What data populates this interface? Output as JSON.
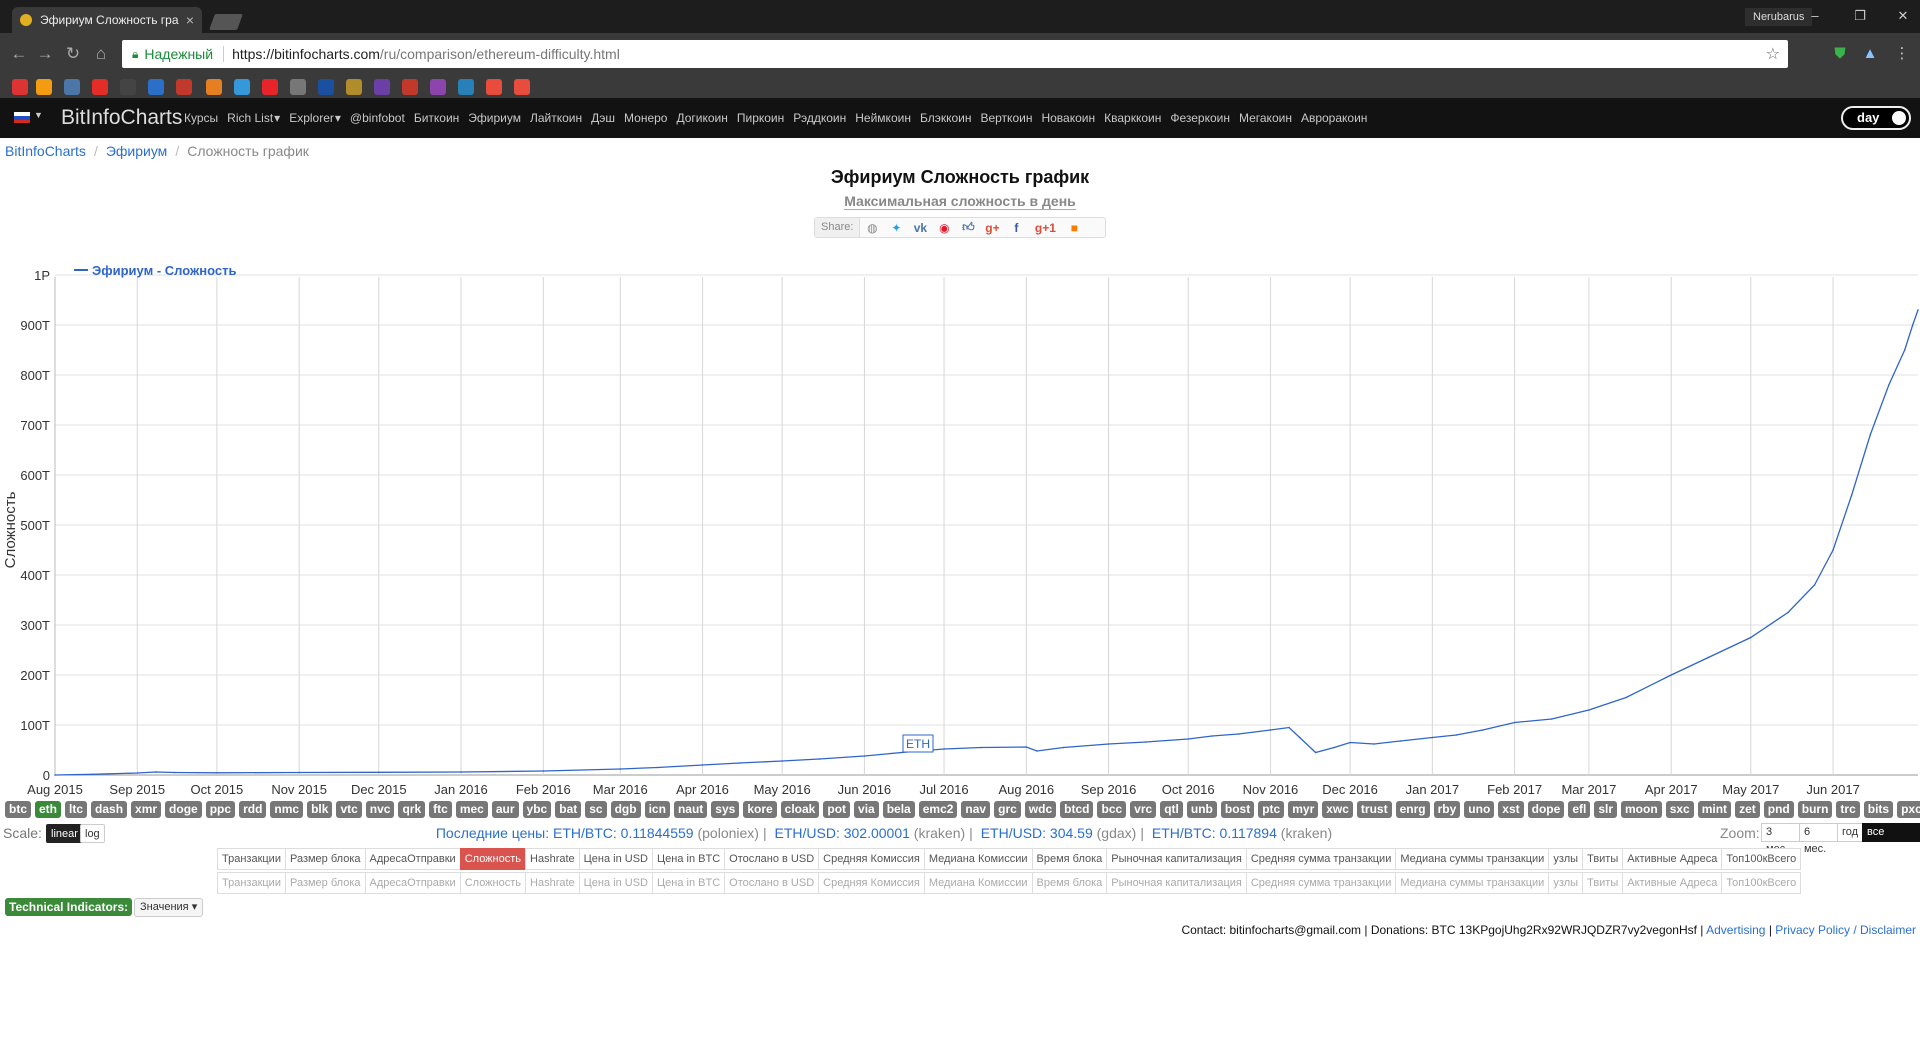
{
  "browser": {
    "tab_title": "Эфириум Сложность гра",
    "profile": "Nerubarus",
    "secure_label": "Надежный",
    "url_host": "https://bitinfocharts.com",
    "url_path": "/ru/comparison/ethereum-difficulty.html",
    "colors": {
      "chrome": "#3a3a3a",
      "tabbar": "#1d1d1d",
      "secure": "#1b8a3a"
    }
  },
  "site": {
    "brand": "BitInfoCharts",
    "nav": [
      "Курсы",
      "Rich List",
      "Explorer",
      "@binfobot",
      "Биткоин",
      "Эфириум",
      "Лайткоин",
      "Дэш",
      "Монеро",
      "Догикоин",
      "Пиркоин",
      "Рэддкоин",
      "Неймкоин",
      "Блэккоин",
      "Верткоин",
      "Новакоин",
      "Кварккоин",
      "Фезеркоин",
      "Мегакоин",
      "Авроракоин"
    ],
    "day_toggle": "day"
  },
  "breadcrumb": {
    "root": "BitInfoCharts",
    "section": "Эфириум",
    "current": "Сложность график"
  },
  "header": {
    "title": "Эфириум Сложность график",
    "subtitle": "Максимальная сложность в день",
    "share_label": "Share:"
  },
  "chart_data": {
    "type": "line",
    "title": "",
    "xlabel": "",
    "ylabel": "Сложность",
    "y_tick_labels": [
      "0",
      "100T",
      "200T",
      "300T",
      "400T",
      "500T",
      "600T",
      "700T",
      "800T",
      "900T",
      "1P"
    ],
    "ylim": [
      0,
      1000
    ],
    "x_tick_labels": [
      "Aug 2015",
      "Sep 2015",
      "Oct 2015",
      "Nov 2015",
      "Dec 2015",
      "Jan 2016",
      "Feb 2016",
      "Mar 2016",
      "Apr 2016",
      "May 2016",
      "Jun 2016",
      "Jul 2016",
      "Aug 2016",
      "Sep 2016",
      "Oct 2016",
      "Nov 2016",
      "Dec 2016",
      "Jan 2017",
      "Feb 2017",
      "Mar 2017",
      "Apr 2017",
      "May 2017",
      "Jun 2017"
    ],
    "grid": true,
    "legend_position": "top-left",
    "annotation": "ETH",
    "series": [
      {
        "name": "Эфириум - Сложность",
        "color": "#2f65c8",
        "points": [
          [
            "2015-08-01",
            0.1
          ],
          [
            "2015-08-15",
            1.5
          ],
          [
            "2015-09-01",
            4
          ],
          [
            "2015-09-08",
            6
          ],
          [
            "2015-09-15",
            5
          ],
          [
            "2015-10-01",
            4.5
          ],
          [
            "2015-11-01",
            5
          ],
          [
            "2015-12-01",
            5.5
          ],
          [
            "2016-01-01",
            6
          ],
          [
            "2016-02-01",
            8
          ],
          [
            "2016-03-01",
            12
          ],
          [
            "2016-03-15",
            15
          ],
          [
            "2016-04-01",
            20
          ],
          [
            "2016-04-15",
            24
          ],
          [
            "2016-05-01",
            28
          ],
          [
            "2016-05-15",
            32
          ],
          [
            "2016-06-01",
            38
          ],
          [
            "2016-06-15",
            45
          ],
          [
            "2016-07-01",
            52
          ],
          [
            "2016-07-15",
            55
          ],
          [
            "2016-08-01",
            56
          ],
          [
            "2016-08-05",
            48
          ],
          [
            "2016-08-15",
            55
          ],
          [
            "2016-09-01",
            62
          ],
          [
            "2016-09-15",
            66
          ],
          [
            "2016-10-01",
            72
          ],
          [
            "2016-10-10",
            78
          ],
          [
            "2016-10-20",
            82
          ],
          [
            "2016-11-01",
            90
          ],
          [
            "2016-11-08",
            95
          ],
          [
            "2016-11-12",
            75
          ],
          [
            "2016-11-18",
            45
          ],
          [
            "2016-11-25",
            55
          ],
          [
            "2016-12-01",
            65
          ],
          [
            "2016-12-10",
            62
          ],
          [
            "2016-12-20",
            68
          ],
          [
            "2017-01-01",
            75
          ],
          [
            "2017-01-10",
            80
          ],
          [
            "2017-01-20",
            90
          ],
          [
            "2017-02-01",
            105
          ],
          [
            "2017-02-15",
            112
          ],
          [
            "2017-03-01",
            130
          ],
          [
            "2017-03-15",
            155
          ],
          [
            "2017-04-01",
            200
          ],
          [
            "2017-04-15",
            235
          ],
          [
            "2017-05-01",
            275
          ],
          [
            "2017-05-15",
            325
          ],
          [
            "2017-05-25",
            380
          ],
          [
            "2017-06-01",
            450
          ],
          [
            "2017-06-08",
            560
          ],
          [
            "2017-06-15",
            680
          ],
          [
            "2017-06-22",
            780
          ],
          [
            "2017-06-28",
            850
          ],
          [
            "2017-07-01",
            900
          ],
          [
            "2017-07-03",
            930
          ]
        ]
      }
    ]
  },
  "coins": [
    "btc",
    "eth",
    "ltc",
    "dash",
    "xmr",
    "doge",
    "ppc",
    "rdd",
    "nmc",
    "blk",
    "vtc",
    "nvc",
    "qrk",
    "ftc",
    "mec",
    "aur",
    "ybc",
    "bat",
    "sc",
    "dgb",
    "icn",
    "naut",
    "sys",
    "kore",
    "cloak",
    "pot",
    "via",
    "bela",
    "emc2",
    "nav",
    "grc",
    "wdc",
    "btcd",
    "bcc",
    "vrc",
    "qtl",
    "unb",
    "bost",
    "ptc",
    "myr",
    "xwc",
    "trust",
    "enrg",
    "rby",
    "uno",
    "xst",
    "dope",
    "efl",
    "slr",
    "moon",
    "sxc",
    "mint",
    "zet",
    "pnd",
    "burn",
    "trc",
    "bits",
    "pxc"
  ],
  "active_coin": "eth",
  "scale": {
    "label": "Scale:",
    "linear": "linear",
    "log": "log"
  },
  "prices": {
    "label": "Последние цены:",
    "items": [
      {
        "pair": "ETH/BTC: 0.11844559",
        "src": "(poloniex)"
      },
      {
        "pair": "ETH/USD: 302.00001",
        "src": "(kraken)"
      },
      {
        "pair": "ETH/USD: 304.59",
        "src": "(gdax)"
      },
      {
        "pair": "ETH/BTC: 0.117894",
        "src": "(kraken)"
      }
    ]
  },
  "zoom": {
    "label": "Zoom:",
    "buttons": [
      "3 мес.",
      "6 мес.",
      "год",
      "все время"
    ],
    "active": "все время"
  },
  "metrics": [
    "Транзакции",
    "Размер блока",
    "АдресаОтправки",
    "Сложность",
    "Hashrate",
    "Цена in USD",
    "Цена in BTC",
    "Отослано в USD",
    "Средняя Комиссия",
    "Медиана Комиссии",
    "Время блока",
    "Рыночная капитализация",
    "Средняя сумма транзакции",
    "Медиана суммы транзакции",
    "узлы",
    "Твиты",
    "Активные Адреса",
    "Топ100кВсего"
  ],
  "active_metric": "Сложность",
  "technical": {
    "button": "Technical Indicators:",
    "select": "Значения"
  },
  "footer": {
    "contact": "Contact: bitinfocharts@gmail.com | Donations: BTC 13KPgojUhg2Rx92WRJQDZR7vy2vegonHsf  |",
    "advertising": "Advertising",
    "sep": "|",
    "privacy": "Privacy Policy / Disclaimer"
  }
}
